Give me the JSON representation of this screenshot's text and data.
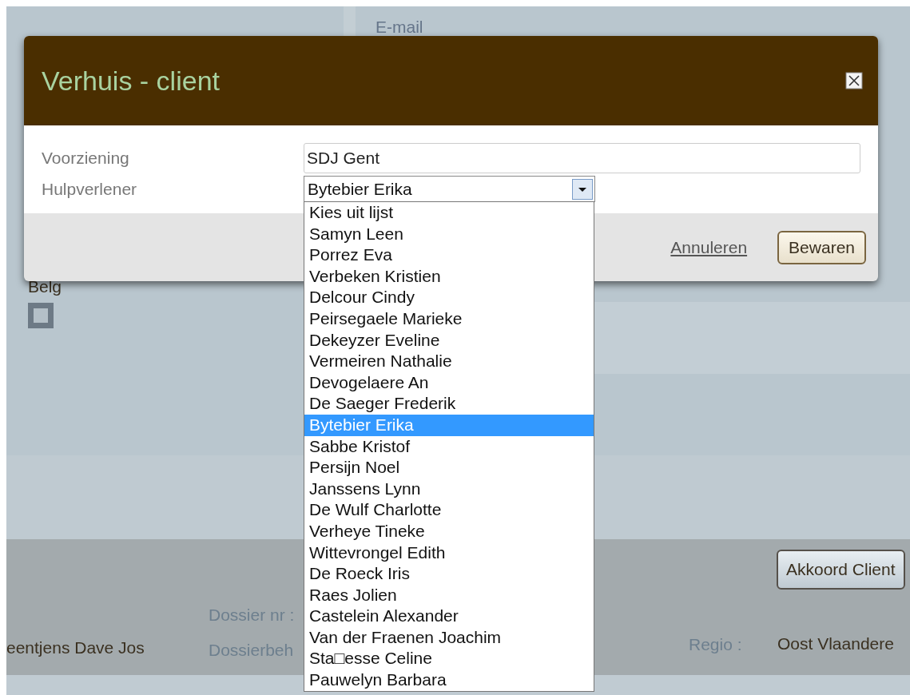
{
  "background": {
    "email_label": "E-mail",
    "nationality": "Belg",
    "checkbox": {
      "checked": false
    },
    "footer": {
      "action_button": "Akkoord Client",
      "client_name": "eentjens Dave Jos",
      "dossier_nr_label": "Dossier nr :",
      "dossier_owner_label": "Dossierbeh",
      "region_label": "Regio :",
      "region_value": "Oost Vlaandere"
    }
  },
  "dialog": {
    "title": "Verhuis - client",
    "fields": [
      {
        "label": "Voorziening",
        "kind": "text",
        "value": "SDJ Gent"
      },
      {
        "label": "Hulpverlener",
        "kind": "select",
        "value": "Bytebier Erika"
      }
    ],
    "cancel_link": "Annuleren",
    "save_button": "Bewaren"
  },
  "dropdown": {
    "options": [
      {
        "label": "Kies uit lijst",
        "selected": false
      },
      {
        "label": "Samyn Leen",
        "selected": false
      },
      {
        "label": "Porrez Eva",
        "selected": false
      },
      {
        "label": "Verbeken Kristien",
        "selected": false
      },
      {
        "label": "Delcour Cindy",
        "selected": false
      },
      {
        "label": "Peirsegaele Marieke",
        "selected": false
      },
      {
        "label": "Dekeyzer Eveline",
        "selected": false
      },
      {
        "label": "Vermeiren Nathalie",
        "selected": false
      },
      {
        "label": "Devogelaere An",
        "selected": false
      },
      {
        "label": "De Saeger Frederik",
        "selected": false
      },
      {
        "label": "Bytebier Erika",
        "selected": true
      },
      {
        "label": "Sabbe Kristof",
        "selected": false
      },
      {
        "label": "Persijn Noel",
        "selected": false
      },
      {
        "label": "Janssens Lynn",
        "selected": false
      },
      {
        "label": "De Wulf Charlotte",
        "selected": false
      },
      {
        "label": "Verheye Tineke",
        "selected": false
      },
      {
        "label": "Wittevrongel Edith",
        "selected": false
      },
      {
        "label": "De Roeck Iris",
        "selected": false
      },
      {
        "label": "Raes Jolien",
        "selected": false
      },
      {
        "label": "Castelein Alexander",
        "selected": false
      },
      {
        "label": "Van der Fraenen Joachim",
        "selected": false
      },
      {
        "label": "Sta□esse Celine",
        "selected": false
      },
      {
        "label": "Pauwelyn Barbara",
        "selected": false
      }
    ]
  }
}
